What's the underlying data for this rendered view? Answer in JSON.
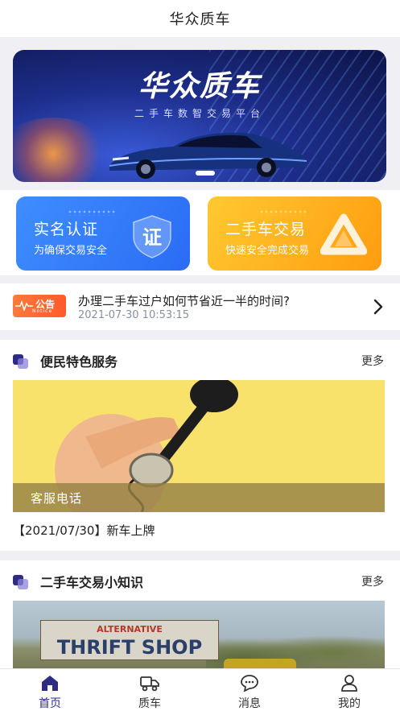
{
  "header": {
    "title": "华众质车"
  },
  "banner": {
    "title": "华众质车",
    "subtitle": "二手车数智交易平台"
  },
  "cards": [
    {
      "title": "实名认证",
      "subtitle": "为确保交易安全",
      "icon": "certificate-shield-icon",
      "icon_text": "证",
      "color": "#2f78f8"
    },
    {
      "title": "二手车交易",
      "subtitle": "快速安全完成交易",
      "icon": "exchange-triangle-icon",
      "color": "#ffae1a"
    }
  ],
  "notice": {
    "badge": "公告",
    "badge_sub": "Notice",
    "title": "办理二手车过户如何节省近一半的时间?",
    "time": "2021-07-30 10:53:15"
  },
  "service_section": {
    "title": "便民特色服务",
    "more": "更多",
    "banner_label": "客服电话",
    "caption": "【2021/07/30】新车上牌"
  },
  "knowledge_section": {
    "title": "二手车交易小知识",
    "more": "更多",
    "image_text_1": "ALTERNATIVE",
    "image_text_2": "THRIFT SHOP"
  },
  "tabbar": {
    "items": [
      {
        "label": "首页",
        "icon": "home-icon",
        "active": true
      },
      {
        "label": "质车",
        "icon": "truck-icon",
        "active": false
      },
      {
        "label": "消息",
        "icon": "message-icon",
        "active": false
      },
      {
        "label": "我的",
        "icon": "user-icon",
        "active": false
      }
    ]
  },
  "colors": {
    "accent": "#2d2c82",
    "notice": "#ff6a33",
    "background": "#efeff4"
  }
}
